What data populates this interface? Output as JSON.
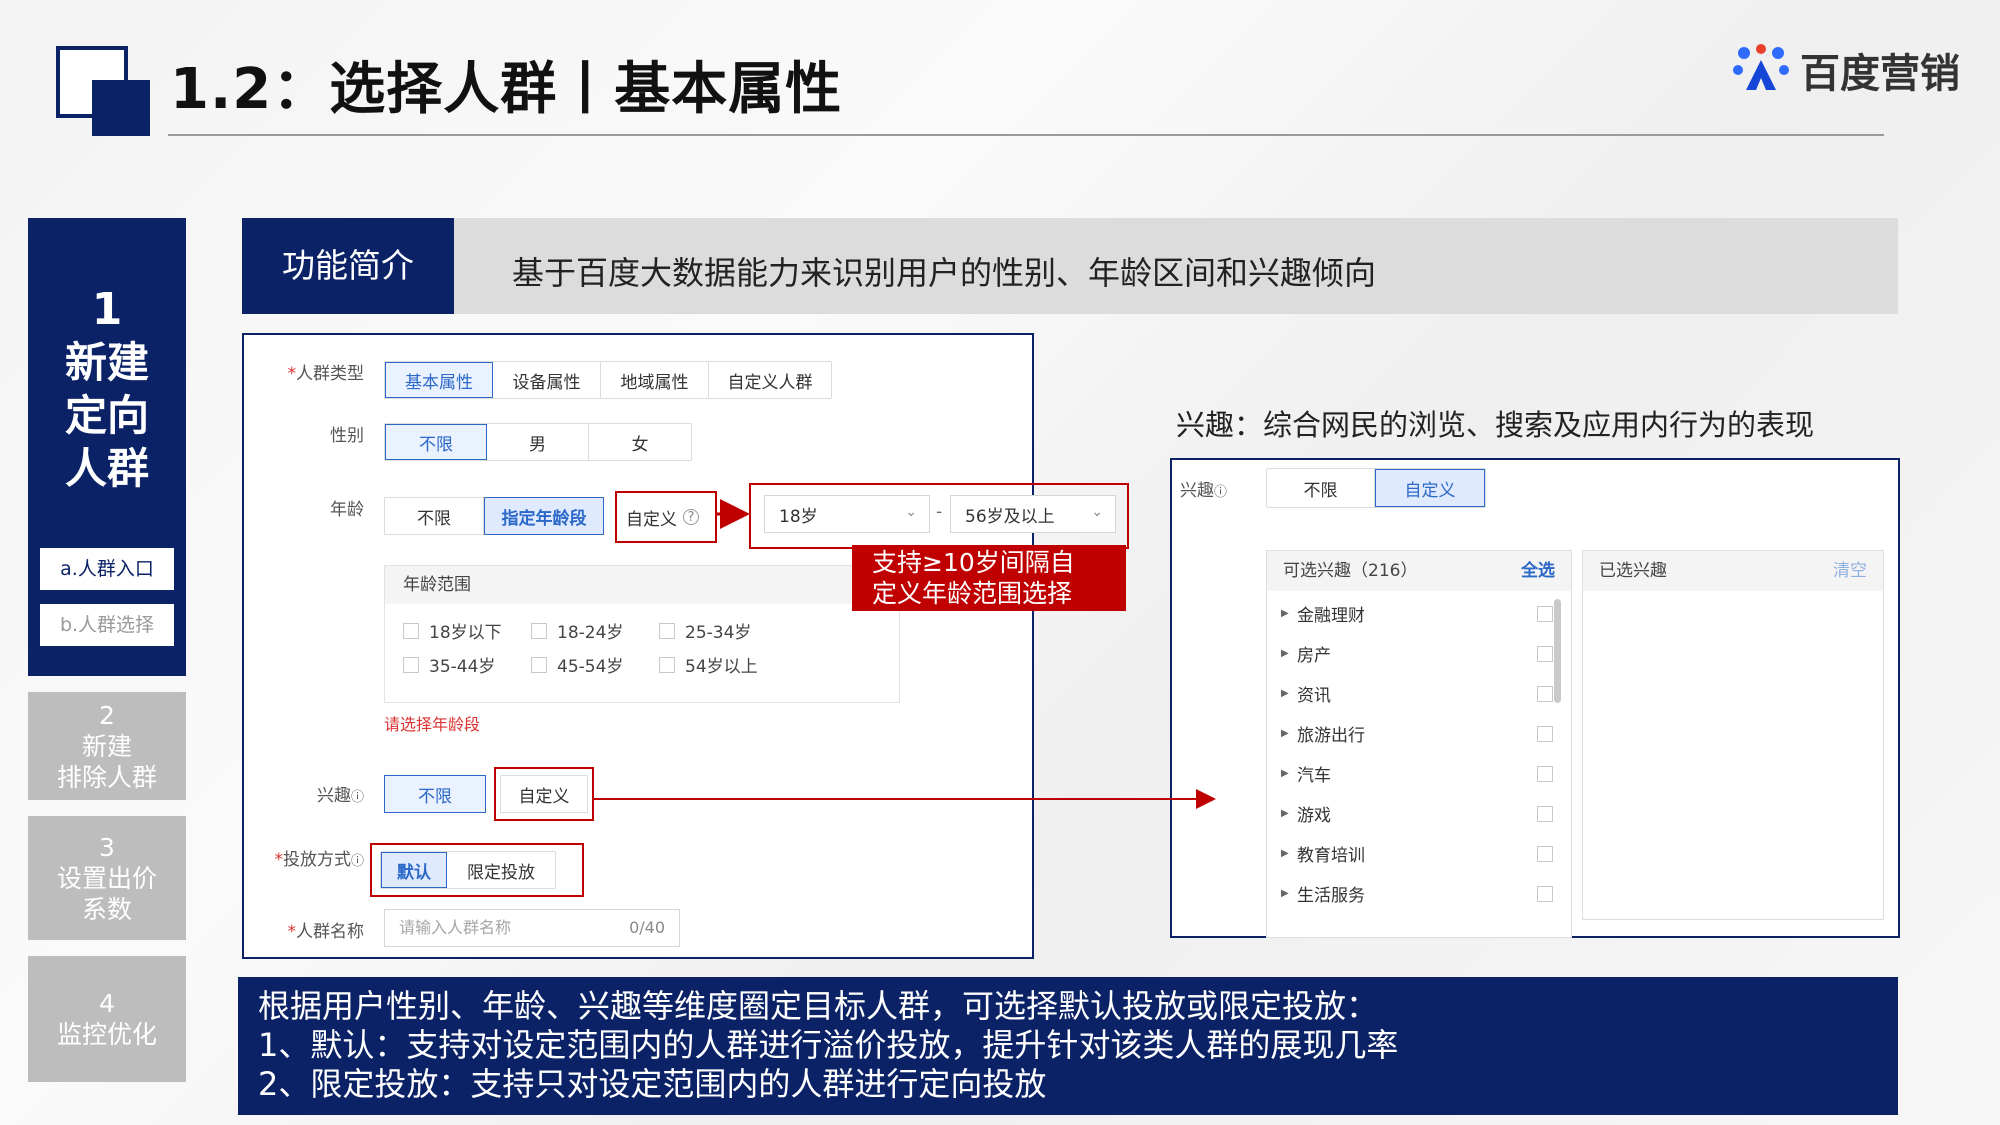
{
  "header": {
    "title": "1.2：选择人群丨基本属性",
    "brand": "百度营销"
  },
  "nav": {
    "active": {
      "num": "1",
      "title_lines": [
        "新建",
        "定向",
        "人群"
      ]
    },
    "sub_items": [
      "a.人群入口",
      "b.人群选择"
    ],
    "items": [
      {
        "num": "2",
        "lines": [
          "新建",
          "排除人群"
        ]
      },
      {
        "num": "3",
        "lines": [
          "设置出价",
          "系数"
        ]
      },
      {
        "num": "4",
        "lines": [
          "监控优化"
        ]
      }
    ]
  },
  "intro": {
    "label": "功能简介",
    "text": "基于百度大数据能力来识别用户的性别、年龄区间和兴趣倾向"
  },
  "form": {
    "crowd_type": {
      "label": "人群类型",
      "options": [
        "基本属性",
        "设备属性",
        "地域属性",
        "自定义人群"
      ],
      "selected": "基本属性"
    },
    "gender": {
      "label": "性别",
      "options": [
        "不限",
        "男",
        "女"
      ],
      "selected": "不限"
    },
    "age": {
      "label": "年龄",
      "options": [
        "不限",
        "指定年龄段",
        "自定义"
      ],
      "selected": "指定年龄段",
      "from": "18岁",
      "to": "56岁及以上",
      "separator": "-",
      "range_title": "年龄范围",
      "ranges": [
        "18岁以下",
        "18-24岁",
        "25-34岁",
        "35-44岁",
        "45-54岁",
        "54岁以上"
      ],
      "warning": "请选择年龄段"
    },
    "interest": {
      "label": "兴趣",
      "options": [
        "不限",
        "自定义"
      ],
      "selected": "不限"
    },
    "delivery": {
      "label": "投放方式",
      "options": [
        "默认",
        "限定投放"
      ],
      "selected": "默认"
    },
    "name": {
      "label": "人群名称",
      "placeholder": "请输入人群名称",
      "count": "0/40"
    }
  },
  "callout": {
    "lines": [
      "支持≥10岁间隔自",
      "定义年龄范围选择"
    ]
  },
  "interest_panel": {
    "note": "兴趣：综合网民的浏览、搜索及应用内行为的表现",
    "label": "兴趣",
    "options": [
      "不限",
      "自定义"
    ],
    "selected": "自定义",
    "available": {
      "title": "可选兴趣（216）",
      "select_all": "全选",
      "items": [
        "金融理财",
        "房产",
        "资讯",
        "旅游出行",
        "汽车",
        "游戏",
        "教育培训",
        "生活服务"
      ]
    },
    "selected_list": {
      "title": "已选兴趣",
      "clear": "清空"
    }
  },
  "description": {
    "lines": [
      "根据用户性别、年龄、兴趣等维度圈定目标人群，可选择默认投放或限定投放：",
      "1、默认：支持对设定范围内的人群进行溢价投放，提升针对该类人群的展现几率",
      "2、限定投放：支持只对设定范围内的人群进行定向投放"
    ]
  },
  "colors": {
    "brand_navy": "#0b2266",
    "accent_red": "#c00000",
    "link_blue": "#2b68c8",
    "inactive_gray": "#bdbdbd"
  }
}
